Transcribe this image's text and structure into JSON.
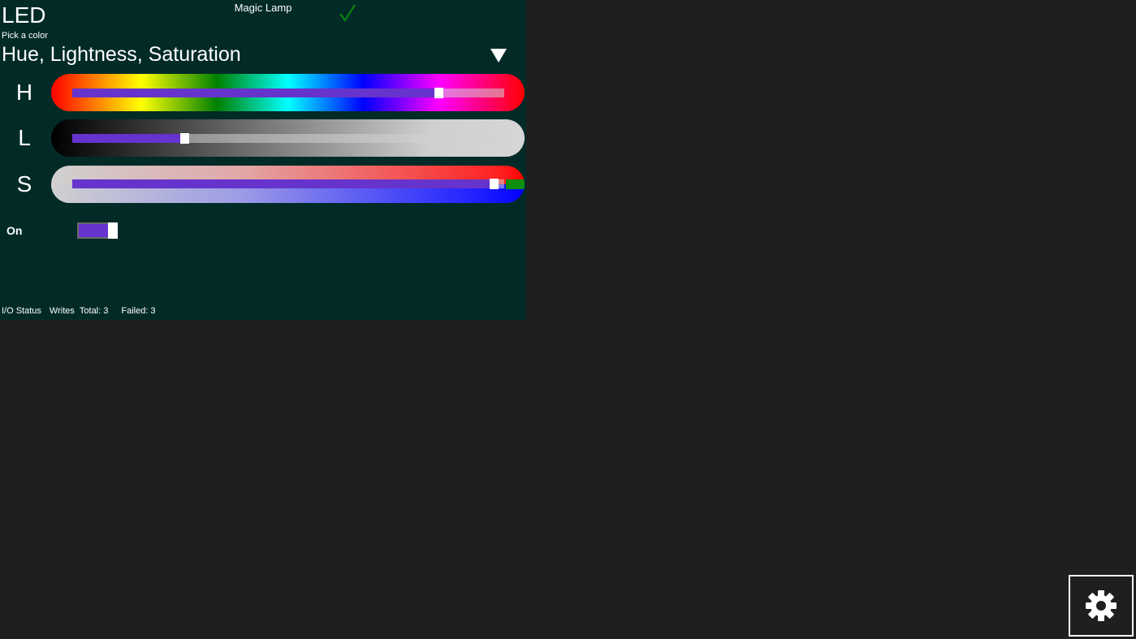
{
  "app": {
    "title": "Magic Lamp",
    "connection_icon": "check-icon",
    "connection_color": "#0a8a0a"
  },
  "device": {
    "name": "LED",
    "subtitle": "Pick a color"
  },
  "color_mode": {
    "selected": "Hue, Lightness, Saturation",
    "icon": "dropdown-triangle-icon"
  },
  "sliders": {
    "hue": {
      "label": "H",
      "value": 0.857
    },
    "lightness": {
      "label": "L",
      "value": 0.255
    },
    "saturation": {
      "label": "S",
      "value": 0.987
    }
  },
  "power": {
    "label": "On",
    "on": true
  },
  "status": {
    "label": "I/O Status",
    "writes_label": "Writes",
    "total": "Total: 3",
    "failed": "Failed: 3"
  },
  "settings": {
    "icon": "gear-icon"
  },
  "colors": {
    "panel_bg": "#022b28",
    "page_bg": "#1f1f1f",
    "accent": "#6633cc"
  }
}
